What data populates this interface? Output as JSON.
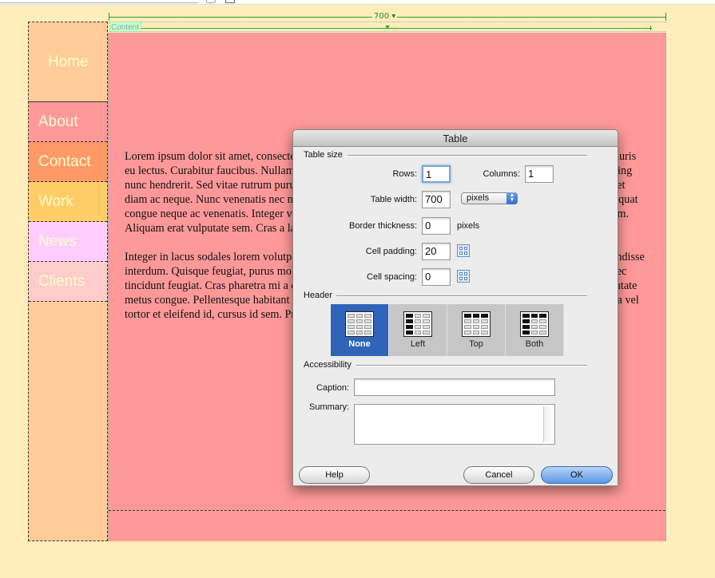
{
  "page": {
    "ruler_label": "700 ▾",
    "content_tag": "Content"
  },
  "nav": {
    "items": [
      "Home",
      "About",
      "Contact",
      "Work",
      "News",
      "Clients"
    ]
  },
  "content": {
    "paragraphs": [
      "Lorem ipsum dolor sit amet, consectetur adipiscing elit. Aenean odio mauris pretium augue, a congue elit mauris eu lectus. Curabitur faucibus. Nullam sit amet risus dui, non aliquet elit. Lorem ipsum dolor sit amet, adipiscing nunc hendrerit. Sed vitae rutrum purus. Nulla facilisi. Aenean vehicula urna, eget faucibus massa. Duis aliquet diam ac neque. Nunc venenatis nec neque nulla. Phasellus mauris risus, pulvinar eget. Nunc commodo consequat congue neque ac venenatis. Integer vulputate pretium augue, odio nec congue imperdiet, neque dui vestibulum. Aliquam erat vulputate sem. Cras a lacus eu tortor.",
      "Integer in lacus sodales lorem volutpat. Integer at vehicula. Nam lacinia hendrerit mauris placerat vel. Suspendisse interdum. Quisque feugiat, purus molestie odio quam at tellus. Morbi at justo ut sapien. Aenean rutrum. Donec tincidunt feugiat. Cras pharetra mi a diam ornare. Nulla facilisi. Nunc lorem tincidunt laoreet sem, eget vulputate metus congue. Pellentesque habitant morbi egestas pellentesque. Sed est est, convallis non ullamcorper. Nulla vel tortor et eleifend id, cursus id sem. Proin quis mi."
    ]
  },
  "dialog": {
    "title": "Table",
    "sections": {
      "table_size": "Table size",
      "header": "Header",
      "accessibility": "Accessibility"
    },
    "fields": {
      "rows_label": "Rows:",
      "rows_value": "1",
      "columns_label": "Columns:",
      "columns_value": "1",
      "table_width_label": "Table width:",
      "table_width_value": "700",
      "width_unit": "pixels",
      "border_label": "Border thickness:",
      "border_value": "0",
      "border_unit": "pixels",
      "cell_padding_label": "Cell padding:",
      "cell_padding_value": "20",
      "cell_spacing_label": "Cell spacing:",
      "cell_spacing_value": "0",
      "caption_label": "Caption:",
      "caption_value": "",
      "summary_label": "Summary:",
      "summary_value": ""
    },
    "header_options": [
      {
        "label": "None",
        "selected": true
      },
      {
        "label": "Left",
        "selected": false
      },
      {
        "label": "Top",
        "selected": false
      },
      {
        "label": "Both",
        "selected": false
      }
    ],
    "buttons": {
      "help": "Help",
      "cancel": "Cancel",
      "ok": "OK"
    }
  },
  "colors": {
    "page_bg": "#ffeebb",
    "content_bg": "#ff9999",
    "nav_text": "#ffffcc",
    "selected_blue": "#2f64b8"
  }
}
